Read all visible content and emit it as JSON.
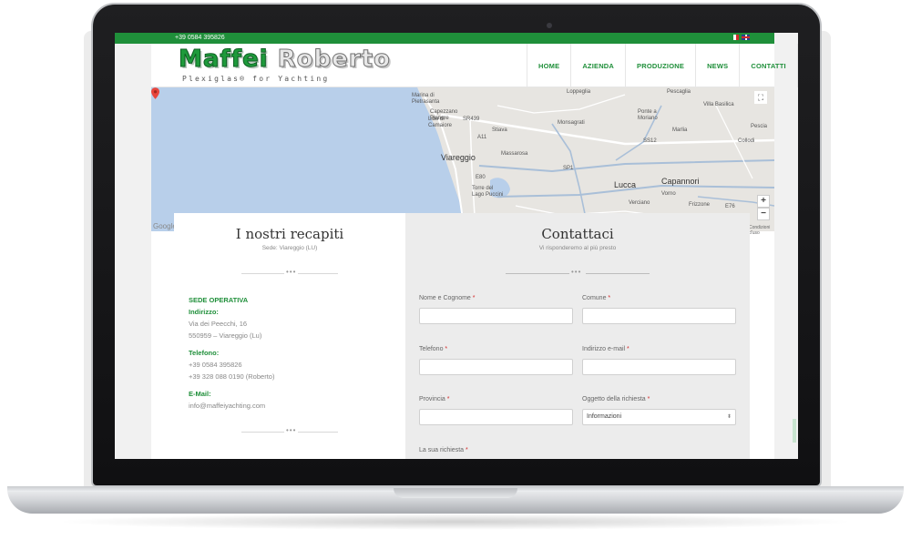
{
  "topbar": {
    "phone": "+39 0584 395826"
  },
  "header": {
    "logo_part1": "Maffei ",
    "logo_part2": "Roberto",
    "logo_sub": "Plexiglas® for Yachting"
  },
  "nav": [
    {
      "label": "HOME"
    },
    {
      "label": "AZIENDA"
    },
    {
      "label": "PRODUZIONE"
    },
    {
      "label": "NEWS"
    },
    {
      "label": "CONTATTI"
    }
  ],
  "map": {
    "labels": {
      "marina": "Marina di\nPietrasanta",
      "capezzano": "Capezzano\nPianore",
      "lido": "Lido di\nCamaiore",
      "stiava": "Stiava",
      "viareggio": "Viareggio",
      "massarosa": "Massarosa",
      "torre": "Torre del\nLago Puccini",
      "monsagrati": "Monsagrati",
      "loppeglia": "Loppeglia",
      "pescaglia": "Pescaglia",
      "moriano": "Ponte a\nMoriano",
      "marlia": "Marlia",
      "lucca": "Lucca",
      "capannori": "Capannori",
      "vorno": "Vorno",
      "verciano": "Verciano",
      "frizzone": "Frizzone",
      "pescia": "Pescia",
      "collodi": "Collodi",
      "villa": "Villa Basilica"
    },
    "road_labels": {
      "sr439": "SR439",
      "a11": "A11",
      "ss12": "SS12",
      "e80": "E80",
      "e76": "E76",
      "sp1": "SP1"
    },
    "google": "Google",
    "terms": "Condizioni d'uso",
    "zoom_in": "+",
    "zoom_out": "−",
    "fullscreen": "⛶"
  },
  "contacts": {
    "title": "I nostri recapiti",
    "subtitle": "Sede: Viareggio (LU)",
    "dots": "•••",
    "sede_label": "SEDE OPERATIVA",
    "indirizzo_label": "Indirizzo:",
    "address_line1": "Via dei Peecchi, 16",
    "address_line2": "550959 – Viareggio (Lu)",
    "telefono_label": "Telefono:",
    "phone1": "+39 0584 395826",
    "phone2": "+39 328 088 0190 (Roberto)",
    "email_label": "E-Mail:",
    "email": "info@maffeiyachting.com"
  },
  "form": {
    "title": "Contattaci",
    "subtitle": "Vi risponderemo al più presto",
    "dots": "•••",
    "required_mark": "*",
    "fields": {
      "nome": {
        "label": "Nome e Cognome ",
        "value": ""
      },
      "comune": {
        "label": "Comune ",
        "value": ""
      },
      "telefono": {
        "label": "Telefono ",
        "value": ""
      },
      "email": {
        "label": "Indirizzo e-mail ",
        "value": ""
      },
      "provincia": {
        "label": "Provincia ",
        "value": ""
      },
      "oggetto": {
        "label": "Oggetto della richiesta ",
        "value": "Informazioni"
      },
      "richiesta": {
        "label": "La sua richiesta "
      }
    },
    "select_arrow": "⬍"
  },
  "colors": {
    "brand_green": "#1f8f3a",
    "map_water": "#b8cfea",
    "map_land": "#e7e5e1",
    "form_bg": "#ececec"
  }
}
